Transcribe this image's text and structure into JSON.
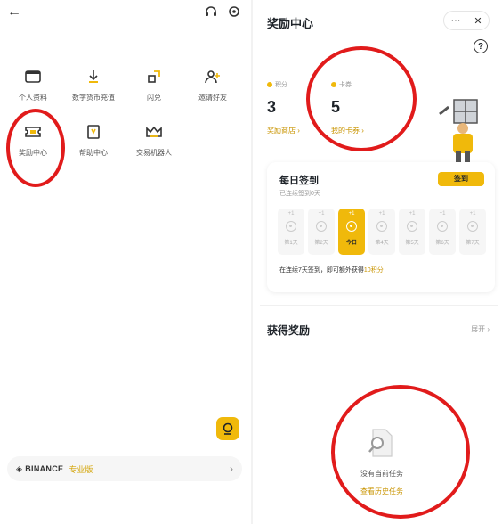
{
  "left": {
    "back_icon": "arrow-left-icon",
    "top_icons": [
      "headset-icon",
      "settings-icon"
    ],
    "grid": [
      {
        "label": "个人资料",
        "icon": "id-card-icon"
      },
      {
        "label": "数字货币充值",
        "icon": "deposit-icon"
      },
      {
        "label": "闪兑",
        "icon": "convert-icon"
      },
      {
        "label": "邀请好友",
        "icon": "add-friend-icon"
      },
      {
        "label": "奖励中心",
        "icon": "ticket-icon"
      },
      {
        "label": "帮助中心",
        "icon": "help-book-icon"
      },
      {
        "label": "交易机器人",
        "icon": "crown-icon"
      }
    ],
    "footer": {
      "brand": "BINANCE",
      "edition": "专业版"
    }
  },
  "right": {
    "title": "奖励中心",
    "more_label": "···",
    "close_label": "✕",
    "help_label": "?",
    "points": {
      "caption": "积分",
      "value": "3",
      "link": "奖励商店 ›"
    },
    "coupons": {
      "caption": "卡券",
      "value": "5",
      "link": "我的卡券 ›"
    },
    "checkin": {
      "title": "每日签到",
      "subtitle": "已连续签到0天",
      "button": "签到",
      "days": [
        {
          "pts": "+1",
          "label": "第1天"
        },
        {
          "pts": "+1",
          "label": "第2天"
        },
        {
          "pts": "+1",
          "label": "今日"
        },
        {
          "pts": "+1",
          "label": "第4天"
        },
        {
          "pts": "+1",
          "label": "第5天"
        },
        {
          "pts": "+1",
          "label": "第6天"
        },
        {
          "pts": "+1",
          "label": "第7天"
        }
      ],
      "today_index": 2,
      "note_prefix": "在连续7天签到，即可额外获得",
      "note_highlight": "10积分"
    },
    "rewards": {
      "title": "获得奖励",
      "expand": "展开 ›",
      "empty_text": "没有当前任务",
      "empty_link": "查看历史任务"
    }
  },
  "colors": {
    "accent": "#f0b90b",
    "link": "#c99400",
    "annotation": "#e11b1b"
  }
}
